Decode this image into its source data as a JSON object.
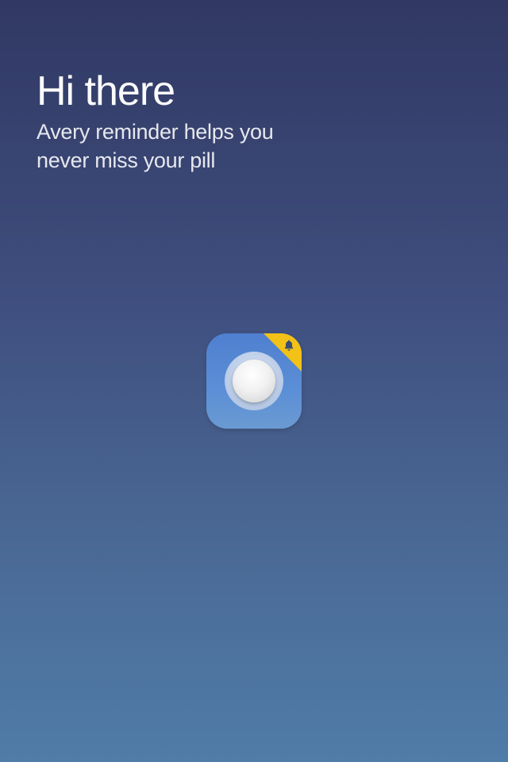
{
  "intro": {
    "title": "Hi there",
    "subtitle": "Avery reminder helps you never miss your pill"
  },
  "app_icon": {
    "icon": "pill-icon",
    "badge_icon": "bell-icon",
    "colors": {
      "background": "#5b8fd6",
      "badge": "#f2c218",
      "pill": "#f1f1f1"
    }
  }
}
